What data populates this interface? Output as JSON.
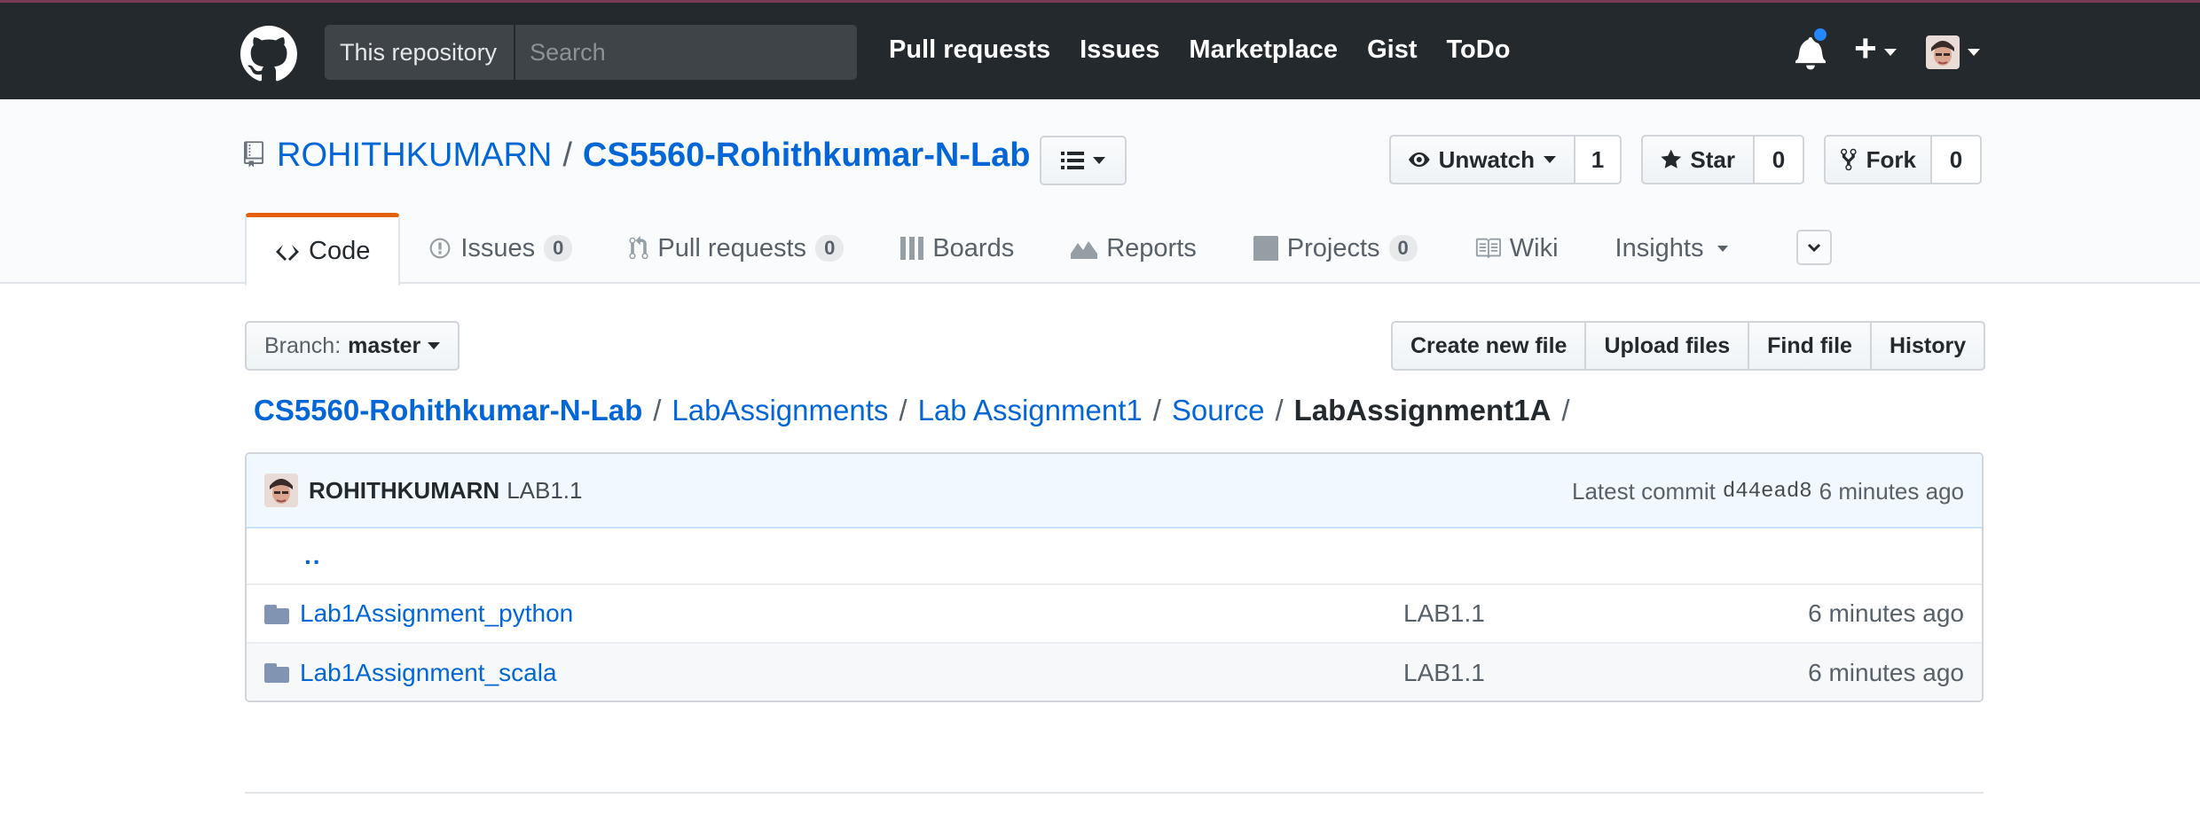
{
  "header": {
    "scope_label": "This repository",
    "search_placeholder": "Search",
    "nav": [
      "Pull requests",
      "Issues",
      "Marketplace",
      "Gist",
      "ToDo"
    ],
    "notification_color": "#2188ff",
    "plus_label": "+"
  },
  "repo": {
    "owner": "ROHITHKUMARN",
    "separator": "/",
    "name": "CS5560-Rohithkumar-N-Lab",
    "actions": {
      "watch_label": "Unwatch",
      "watch_count": "1",
      "star_label": "Star",
      "star_count": "0",
      "fork_label": "Fork",
      "fork_count": "0"
    },
    "tabs": [
      {
        "label": "Code",
        "icon": "code-icon",
        "selected": true
      },
      {
        "label": "Issues",
        "icon": "issue-icon",
        "counter": "0"
      },
      {
        "label": "Pull requests",
        "icon": "pull-request-icon",
        "counter": "0"
      },
      {
        "label": "Boards",
        "icon": "boards-icon"
      },
      {
        "label": "Reports",
        "icon": "reports-icon"
      },
      {
        "label": "Projects",
        "icon": "project-icon",
        "counter": "0"
      },
      {
        "label": "Wiki",
        "icon": "book-icon"
      },
      {
        "label": "Insights",
        "icon": ""
      }
    ]
  },
  "filenav": {
    "branch_label": "Branch:",
    "branch_value": "master",
    "buttons": [
      "Create new file",
      "Upload files",
      "Find file",
      "History"
    ],
    "breadcrumb": {
      "root": "CS5560-Rohithkumar-N-Lab",
      "parts": [
        "LabAssignments",
        "Lab Assignment1",
        "Source"
      ],
      "final": "LabAssignment1A",
      "sep": "/"
    }
  },
  "commit": {
    "author": "ROHITHKUMARN",
    "message": "LAB1.1",
    "latest_label": "Latest commit",
    "sha": "d44ead8",
    "age": "6 minutes ago"
  },
  "files": {
    "up_link": "..",
    "rows": [
      {
        "name": "Lab1Assignment_python",
        "message": "LAB1.1",
        "age": "6 minutes ago"
      },
      {
        "name": "Lab1Assignment_scala",
        "message": "LAB1.1",
        "age": "6 minutes ago"
      }
    ]
  },
  "colors": {
    "accent": "#0366d6",
    "header_bg": "#24292e",
    "selected_tab_border": "#e36209"
  }
}
